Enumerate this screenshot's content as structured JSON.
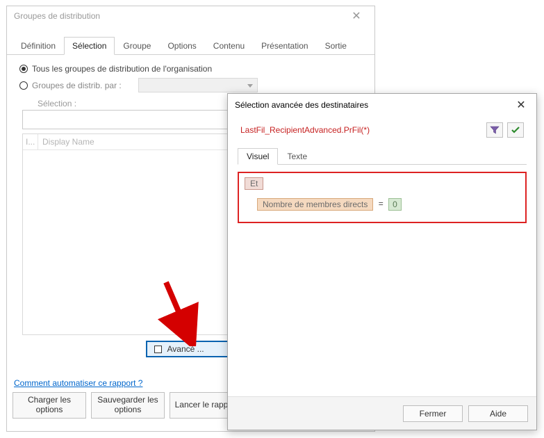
{
  "main": {
    "title": "Groupes de distribution",
    "tabs": [
      "Définition",
      "Sélection",
      "Groupe",
      "Options",
      "Contenu",
      "Présentation",
      "Sortie"
    ],
    "active_tab_index": 1,
    "radio_all": "Tous les groupes de distribution de l'organisation",
    "radio_by": "Groupes de distrib. par :",
    "selection_label": "Sélection :",
    "list_col0": "I...",
    "list_col1": "Display Name",
    "advanced_label": "Avancé ...",
    "link": "Comment automatiser ce rapport ?",
    "buttons": {
      "load": "Charger les options",
      "save": "Sauvegarder les options",
      "run": "Lancer  le rapport"
    }
  },
  "dialog": {
    "title": "Sélection avancée des destinataires",
    "filename": "LastFil_RecipientAdvanced.PrFil(*)",
    "tabs": [
      "Visuel",
      "Texte"
    ],
    "active_tab_index": 0,
    "expr": {
      "op": "Et",
      "field": "Nombre de membres directs",
      "cmp": "=",
      "value": "0"
    },
    "buttons": {
      "close": "Fermer",
      "help": "Aide"
    }
  }
}
